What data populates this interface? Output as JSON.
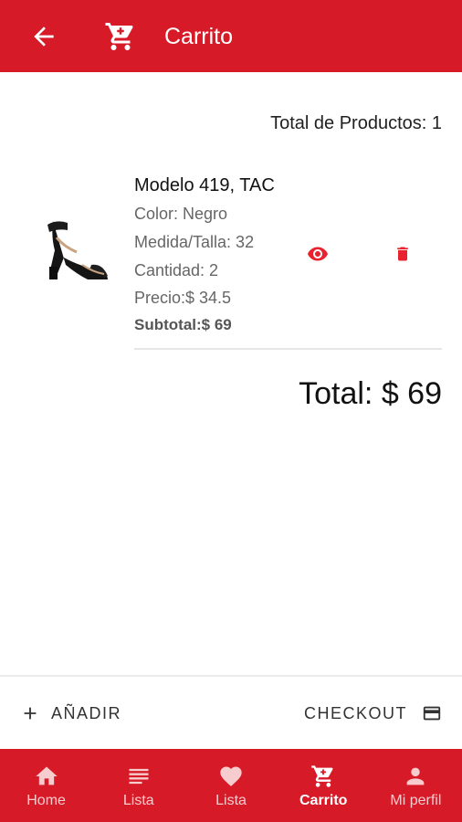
{
  "colors": {
    "primary": "#d71a27",
    "icon_action": "#e8232f"
  },
  "header": {
    "title": "Carrito",
    "back_icon": "arrow-back-icon",
    "cart_icon": "shopping-cart-icon"
  },
  "summary": {
    "total_products": "Total de Productos: 1"
  },
  "cart_items": [
    {
      "name": "Modelo 419, TAC",
      "color": "Color: Negro",
      "size": "Medida/Talla: 32",
      "quantity": "Cantidad: 2",
      "price": "Precio:$ 34.5",
      "subtotal": "Subtotal:$ 69",
      "image": "black-heeled-sandal"
    }
  ],
  "total": "Total: $ 69",
  "actions": {
    "add_label": "AÑADIR",
    "checkout_label": "CHECKOUT"
  },
  "nav": [
    {
      "label": "Home",
      "icon": "home-icon"
    },
    {
      "label": "Lista",
      "icon": "list-icon"
    },
    {
      "label": "Lista",
      "icon": "heart-icon"
    },
    {
      "label": "Carrito",
      "icon": "shopping-cart-icon",
      "active": true
    },
    {
      "label": "Mi perfil",
      "icon": "person-icon"
    }
  ]
}
